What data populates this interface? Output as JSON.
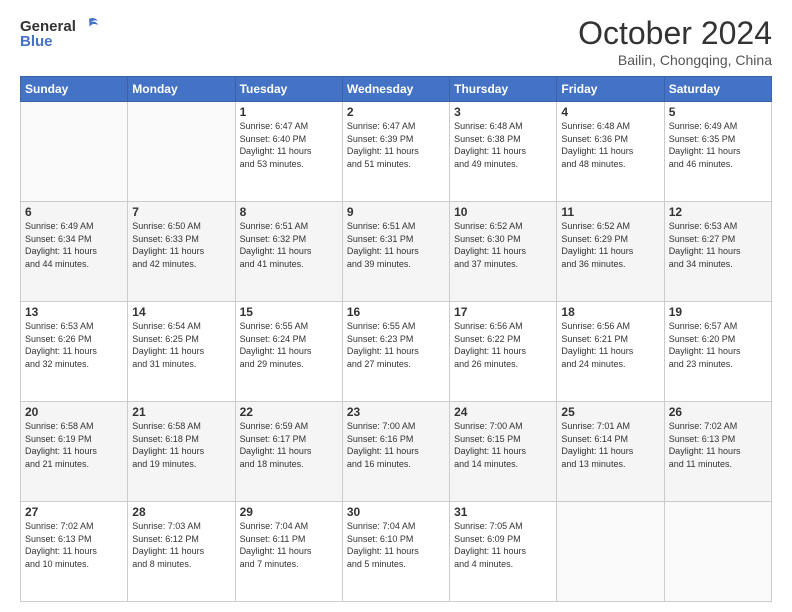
{
  "header": {
    "logo": {
      "general": "General",
      "blue": "Blue"
    },
    "title": "October 2024",
    "location": "Bailin, Chongqing, China"
  },
  "weekdays": [
    "Sunday",
    "Monday",
    "Tuesday",
    "Wednesday",
    "Thursday",
    "Friday",
    "Saturday"
  ],
  "weeks": [
    [
      {
        "day": "",
        "info": ""
      },
      {
        "day": "",
        "info": ""
      },
      {
        "day": "1",
        "info": "Sunrise: 6:47 AM\nSunset: 6:40 PM\nDaylight: 11 hours\nand 53 minutes."
      },
      {
        "day": "2",
        "info": "Sunrise: 6:47 AM\nSunset: 6:39 PM\nDaylight: 11 hours\nand 51 minutes."
      },
      {
        "day": "3",
        "info": "Sunrise: 6:48 AM\nSunset: 6:38 PM\nDaylight: 11 hours\nand 49 minutes."
      },
      {
        "day": "4",
        "info": "Sunrise: 6:48 AM\nSunset: 6:36 PM\nDaylight: 11 hours\nand 48 minutes."
      },
      {
        "day": "5",
        "info": "Sunrise: 6:49 AM\nSunset: 6:35 PM\nDaylight: 11 hours\nand 46 minutes."
      }
    ],
    [
      {
        "day": "6",
        "info": "Sunrise: 6:49 AM\nSunset: 6:34 PM\nDaylight: 11 hours\nand 44 minutes."
      },
      {
        "day": "7",
        "info": "Sunrise: 6:50 AM\nSunset: 6:33 PM\nDaylight: 11 hours\nand 42 minutes."
      },
      {
        "day": "8",
        "info": "Sunrise: 6:51 AM\nSunset: 6:32 PM\nDaylight: 11 hours\nand 41 minutes."
      },
      {
        "day": "9",
        "info": "Sunrise: 6:51 AM\nSunset: 6:31 PM\nDaylight: 11 hours\nand 39 minutes."
      },
      {
        "day": "10",
        "info": "Sunrise: 6:52 AM\nSunset: 6:30 PM\nDaylight: 11 hours\nand 37 minutes."
      },
      {
        "day": "11",
        "info": "Sunrise: 6:52 AM\nSunset: 6:29 PM\nDaylight: 11 hours\nand 36 minutes."
      },
      {
        "day": "12",
        "info": "Sunrise: 6:53 AM\nSunset: 6:27 PM\nDaylight: 11 hours\nand 34 minutes."
      }
    ],
    [
      {
        "day": "13",
        "info": "Sunrise: 6:53 AM\nSunset: 6:26 PM\nDaylight: 11 hours\nand 32 minutes."
      },
      {
        "day": "14",
        "info": "Sunrise: 6:54 AM\nSunset: 6:25 PM\nDaylight: 11 hours\nand 31 minutes."
      },
      {
        "day": "15",
        "info": "Sunrise: 6:55 AM\nSunset: 6:24 PM\nDaylight: 11 hours\nand 29 minutes."
      },
      {
        "day": "16",
        "info": "Sunrise: 6:55 AM\nSunset: 6:23 PM\nDaylight: 11 hours\nand 27 minutes."
      },
      {
        "day": "17",
        "info": "Sunrise: 6:56 AM\nSunset: 6:22 PM\nDaylight: 11 hours\nand 26 minutes."
      },
      {
        "day": "18",
        "info": "Sunrise: 6:56 AM\nSunset: 6:21 PM\nDaylight: 11 hours\nand 24 minutes."
      },
      {
        "day": "19",
        "info": "Sunrise: 6:57 AM\nSunset: 6:20 PM\nDaylight: 11 hours\nand 23 minutes."
      }
    ],
    [
      {
        "day": "20",
        "info": "Sunrise: 6:58 AM\nSunset: 6:19 PM\nDaylight: 11 hours\nand 21 minutes."
      },
      {
        "day": "21",
        "info": "Sunrise: 6:58 AM\nSunset: 6:18 PM\nDaylight: 11 hours\nand 19 minutes."
      },
      {
        "day": "22",
        "info": "Sunrise: 6:59 AM\nSunset: 6:17 PM\nDaylight: 11 hours\nand 18 minutes."
      },
      {
        "day": "23",
        "info": "Sunrise: 7:00 AM\nSunset: 6:16 PM\nDaylight: 11 hours\nand 16 minutes."
      },
      {
        "day": "24",
        "info": "Sunrise: 7:00 AM\nSunset: 6:15 PM\nDaylight: 11 hours\nand 14 minutes."
      },
      {
        "day": "25",
        "info": "Sunrise: 7:01 AM\nSunset: 6:14 PM\nDaylight: 11 hours\nand 13 minutes."
      },
      {
        "day": "26",
        "info": "Sunrise: 7:02 AM\nSunset: 6:13 PM\nDaylight: 11 hours\nand 11 minutes."
      }
    ],
    [
      {
        "day": "27",
        "info": "Sunrise: 7:02 AM\nSunset: 6:13 PM\nDaylight: 11 hours\nand 10 minutes."
      },
      {
        "day": "28",
        "info": "Sunrise: 7:03 AM\nSunset: 6:12 PM\nDaylight: 11 hours\nand 8 minutes."
      },
      {
        "day": "29",
        "info": "Sunrise: 7:04 AM\nSunset: 6:11 PM\nDaylight: 11 hours\nand 7 minutes."
      },
      {
        "day": "30",
        "info": "Sunrise: 7:04 AM\nSunset: 6:10 PM\nDaylight: 11 hours\nand 5 minutes."
      },
      {
        "day": "31",
        "info": "Sunrise: 7:05 AM\nSunset: 6:09 PM\nDaylight: 11 hours\nand 4 minutes."
      },
      {
        "day": "",
        "info": ""
      },
      {
        "day": "",
        "info": ""
      }
    ]
  ]
}
